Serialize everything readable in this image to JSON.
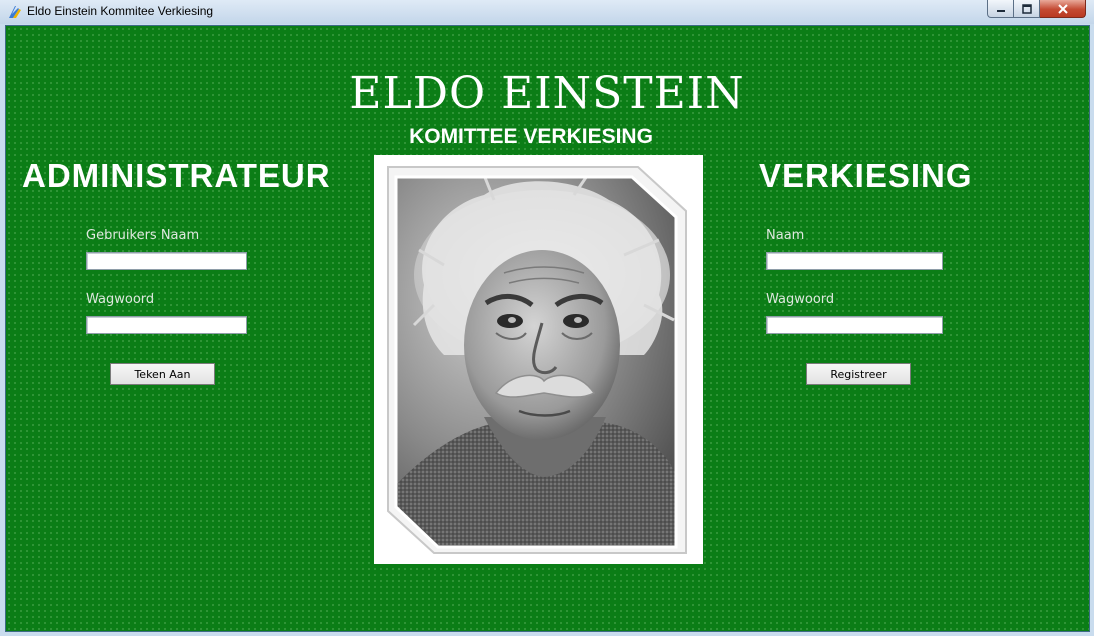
{
  "window": {
    "title": "Eldo Einstein Kommitee Verkiesing",
    "icon": "app-icon",
    "controls": [
      "minimize-icon",
      "maximize-icon",
      "close-icon"
    ]
  },
  "header": {
    "title": "ELDO EINSTEIN",
    "subtitle": "KOMITTEE VERKIESING"
  },
  "admin": {
    "heading": "ADMINISTRATEUR",
    "username_label": "Gebruikers Naam",
    "username_value": "",
    "password_label": "Wagwoord",
    "password_value": "",
    "login_button": "Teken Aan"
  },
  "election": {
    "heading": "VERKIESING",
    "name_label": "Naam",
    "name_value": "",
    "password_label": "Wagwoord",
    "password_value": "",
    "register_button": "Registreer"
  },
  "photo": {
    "icon": "portrait-photo"
  },
  "colors": {
    "background": "#0b7d16",
    "text": "#ffffff",
    "titlebar": "#dfeaf6",
    "close_button": "#c44a33"
  }
}
